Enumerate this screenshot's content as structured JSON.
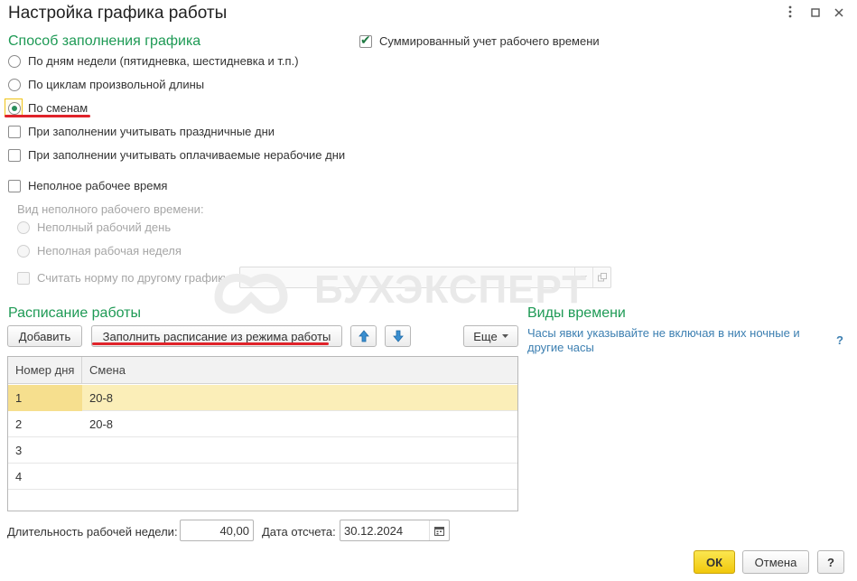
{
  "window": {
    "title": "Настройка графика работы",
    "menu_icon": "more-vertical-icon",
    "maximize_icon": "maximize-icon",
    "close_icon": "close-icon"
  },
  "fill_method": {
    "title": "Способ заполнения графика",
    "options": [
      {
        "label": "По дням недели (пятидневка, шестидневка и т.п.)",
        "checked": false
      },
      {
        "label": "По циклам произвольной длины",
        "checked": false
      },
      {
        "label": "По сменам",
        "checked": true
      }
    ],
    "holidays_label": "При заполнении учитывать праздничные дни",
    "paid_days_label": "При заполнении учитывать оплачиваемые нерабочие дни",
    "summarized_label": "Суммированный учет рабочего времени",
    "summarized_checked": true
  },
  "part_time": {
    "label": "Неполное рабочее время",
    "type_label": "Вид неполного рабочего времени:",
    "options": [
      "Неполный рабочий день",
      "Неполная рабочая неделя"
    ],
    "norm_label": "Считать норму по другому графику:",
    "norm_value": ""
  },
  "watermark": "БУХЭКСПЕРТ",
  "schedule": {
    "title": "Расписание работы",
    "add_button": "Добавить",
    "fill_button": "Заполнить расписание из режима работы",
    "more_button": "Еще",
    "columns": [
      "Номер дня",
      "Смена"
    ],
    "rows": [
      {
        "day": "1",
        "shift": "20-8"
      },
      {
        "day": "2",
        "shift": "20-8"
      },
      {
        "day": "3",
        "shift": ""
      },
      {
        "day": "4",
        "shift": ""
      }
    ]
  },
  "time_types": {
    "title": "Виды времени",
    "hint_line1": "Часы явки указывайте не включая в них ночные и",
    "hint_line2": "другие часы",
    "help": "?"
  },
  "footer": {
    "week_length_label": "Длительность рабочей недели:",
    "week_length_value": "40,00",
    "ref_date_label": "Дата отсчета:",
    "ref_date_value": "30.12.2024",
    "ok_button": "ОК",
    "cancel_button": "Отмена",
    "help_button": "?"
  },
  "colors": {
    "section_title": "#1e9a55",
    "hint": "#3c7fb1",
    "accent_ok": "#f1c80c",
    "underline": "#e0232a",
    "selected_row": "#fbeeb8"
  }
}
